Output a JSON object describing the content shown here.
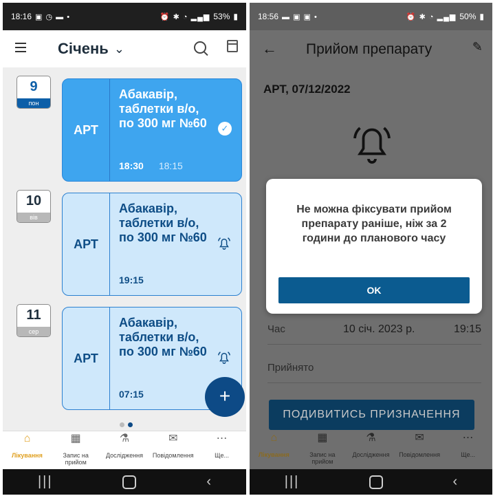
{
  "left": {
    "status": {
      "time": "18:16",
      "battery": "53%"
    },
    "header": {
      "month": "Січень"
    },
    "entries": [
      {
        "day_num": "9",
        "day_name": "пон",
        "kind": "АРТ",
        "name": "Абакавір, таблетки в/о, по 300 мг №60",
        "time": "18:30",
        "taken_time": "18:15",
        "status": "taken"
      },
      {
        "day_num": "10",
        "day_name": "вів",
        "kind": "АРТ",
        "name": "Абакавір, таблетки в/о, по 300 мг №60",
        "time": "19:15",
        "taken_time": "",
        "status": "reminder"
      },
      {
        "day_num": "11",
        "day_name": "сер",
        "kind": "АРТ",
        "name": "Абакавір, таблетки в/о, по 300 мг №60",
        "time": "07:15",
        "taken_time": "",
        "status": "reminder"
      }
    ],
    "fab": "+"
  },
  "right": {
    "status": {
      "time": "18:56",
      "battery": "50%"
    },
    "header": {
      "title": "Прийом препарату"
    },
    "art_date": "АРТ, 07/12/2022",
    "time_row": {
      "label": "Час",
      "date": "10 січ. 2023 р.",
      "time": "19:15"
    },
    "taken_row": {
      "label": "Прийнято"
    },
    "prescription_button": "ПОДИВИТИСЬ ПРИЗНАЧЕННЯ",
    "dialog": {
      "message": "Не можна фіксувати прийом препарату раніше, ніж за 2 години до планового часу",
      "ok_label": "OK"
    }
  },
  "nav": [
    {
      "label": "Лікування",
      "icon": "home-icon"
    },
    {
      "label": "Запис на прийом",
      "icon": "calendar-icon"
    },
    {
      "label": "Дослідження",
      "icon": "flask-icon"
    },
    {
      "label": "Повідомлення",
      "icon": "message-icon"
    },
    {
      "label": "Ще...",
      "icon": "more-icon"
    }
  ],
  "colors": {
    "accent": "#3ea5ef",
    "primary_dark": "#0d4a86",
    "nav_active": "#e0a020"
  }
}
